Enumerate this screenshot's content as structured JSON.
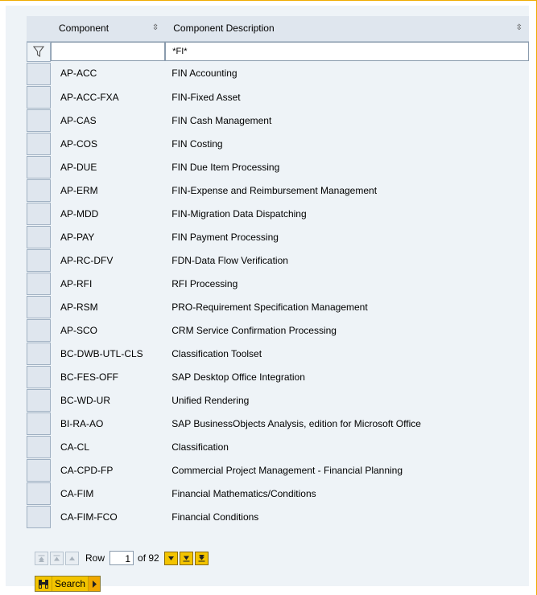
{
  "columns": {
    "component": "Component",
    "description": "Component Description"
  },
  "filter": {
    "component": "",
    "description": "*FI*"
  },
  "rows": [
    {
      "component": "AP-ACC",
      "description": "FIN Accounting"
    },
    {
      "component": "AP-ACC-FXA",
      "description": "FIN-Fixed Asset"
    },
    {
      "component": "AP-CAS",
      "description": "FIN Cash Management"
    },
    {
      "component": "AP-COS",
      "description": "FIN Costing"
    },
    {
      "component": "AP-DUE",
      "description": "FIN Due Item Processing"
    },
    {
      "component": "AP-ERM",
      "description": "FIN-Expense and Reimbursement Management"
    },
    {
      "component": "AP-MDD",
      "description": "FIN-Migration Data Dispatching"
    },
    {
      "component": "AP-PAY",
      "description": "FIN Payment Processing"
    },
    {
      "component": "AP-RC-DFV",
      "description": "FDN-Data Flow Verification"
    },
    {
      "component": "AP-RFI",
      "description": "RFI Processing"
    },
    {
      "component": "AP-RSM",
      "description": "PRO-Requirement Specification Management"
    },
    {
      "component": "AP-SCO",
      "description": "CRM Service Confirmation Processing"
    },
    {
      "component": "BC-DWB-UTL-CLS",
      "description": "Classification Toolset"
    },
    {
      "component": "BC-FES-OFF",
      "description": "SAP Desktop Office Integration"
    },
    {
      "component": "BC-WD-UR",
      "description": "Unified Rendering"
    },
    {
      "component": "BI-RA-AO",
      "description": "SAP BusinessObjects Analysis, edition for Microsoft Office"
    },
    {
      "component": "CA-CL",
      "description": "Classification"
    },
    {
      "component": "CA-CPD-FP",
      "description": "Commercial Project Management - Financial Planning"
    },
    {
      "component": "CA-FIM",
      "description": "Financial Mathematics/Conditions"
    },
    {
      "component": "CA-FIM-FCO",
      "description": "Financial Conditions"
    }
  ],
  "pager": {
    "row_label": "Row",
    "current_row": "1",
    "of_label": "of 92"
  },
  "search": {
    "label": "Search"
  },
  "colors": {
    "accent": "#f3c400",
    "header_bg": "#dfe6ee",
    "panel_bg": "#eef3f7",
    "frame_border": "#f0ab00"
  }
}
